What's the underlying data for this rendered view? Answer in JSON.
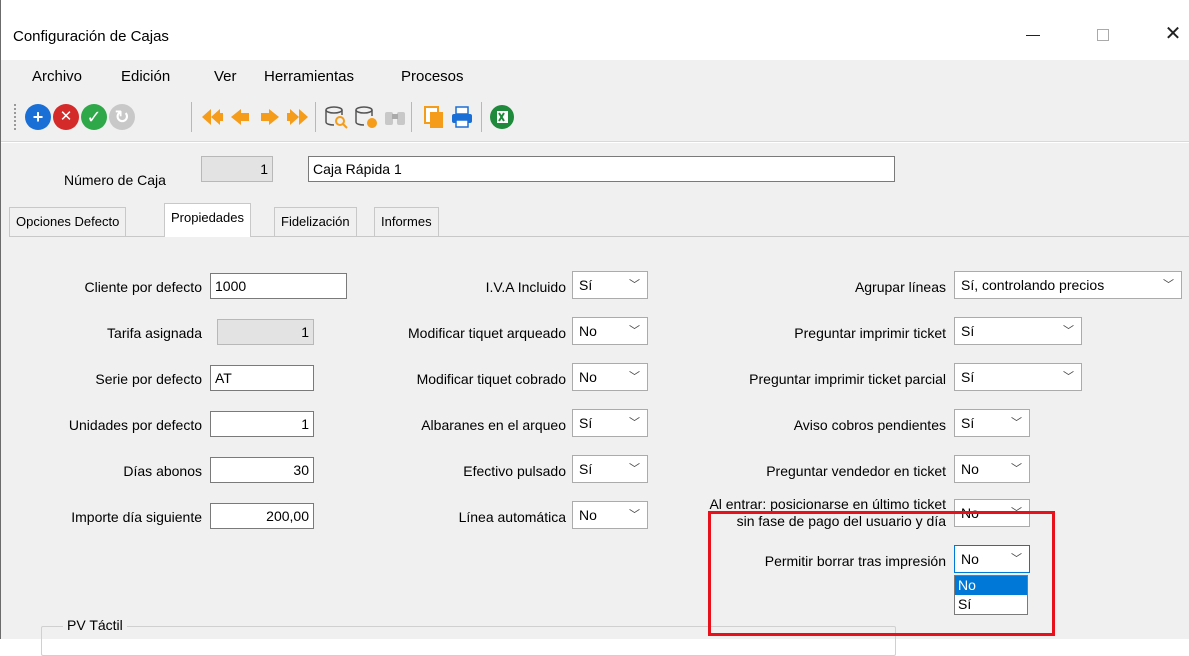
{
  "window": {
    "title": "Configuración de Cajas",
    "minimize_icon": "minimize-icon",
    "maximize_icon": "maximize-icon",
    "close_glyph": "✕"
  },
  "menu": [
    "Archivo",
    "Edición",
    "Ver",
    "Herramientas",
    "Procesos"
  ],
  "toolbar": {
    "new_icon": "+",
    "delete_icon": "✕",
    "accept_icon": "✓",
    "undo_icon": "↻",
    "colors": {
      "new": "#1a6fd6",
      "delete": "#d42a2a",
      "accept": "#2fa84a",
      "undo": "#c8c8c8",
      "nav": "#f59c1a",
      "print": "#1a6fd6",
      "excel": "#1f8a3b"
    }
  },
  "header": {
    "caja_label": "Número de Caja",
    "caja_number": "1",
    "caja_name": "Caja Rápida 1"
  },
  "tabs": [
    "Opciones Defecto",
    "Propiedades",
    "Fidelización",
    "Informes"
  ],
  "active_tab": "Propiedades",
  "col1": {
    "cliente_label": "Cliente por defecto",
    "cliente_value": "1000",
    "tarifa_label": "Tarifa asignada",
    "tarifa_value": "1",
    "serie_label": "Serie por defecto",
    "serie_value": "AT",
    "unidades_label": "Unidades por defecto",
    "unidades_value": "1",
    "dias_label": "Días abonos",
    "dias_value": "30",
    "importe_label": "Importe día siguiente",
    "importe_value": "200,00"
  },
  "col2": {
    "iva_label": "I.V.A Incluido",
    "iva_value": "Sí",
    "mod_arqueado_label": "Modificar tiquet arqueado",
    "mod_arqueado_value": "No",
    "mod_cobrado_label": "Modificar tiquet cobrado",
    "mod_cobrado_value": "No",
    "albaranes_label": "Albaranes en el arqueo",
    "albaranes_value": "Sí",
    "efectivo_label": "Efectivo pulsado",
    "efectivo_value": "Sí",
    "linea_label": "Línea automática",
    "linea_value": "No"
  },
  "col3": {
    "agrupar_label": "Agrupar líneas",
    "agrupar_value": "Sí, controlando precios",
    "imprimir_label": "Preguntar imprimir ticket",
    "imprimir_value": "Sí",
    "imprimir_parcial_label": "Preguntar imprimir ticket parcial",
    "imprimir_parcial_value": "Sí",
    "aviso_label": "Aviso cobros pendientes",
    "aviso_value": "Sí",
    "vendedor_label": "Preguntar vendedor en ticket",
    "vendedor_value": "No",
    "posicionarse_label_1": "Al entrar: posicionarse en último ticket",
    "posicionarse_label_2": "sin fase de pago del usuario y día",
    "posicionarse_value": "No",
    "borrar_label": "Permitir borrar tras impresión",
    "borrar_value": "No",
    "borrar_options": [
      "No",
      "Sí"
    ]
  },
  "group": {
    "title": "PV Táctil"
  },
  "chevron": "﹀"
}
